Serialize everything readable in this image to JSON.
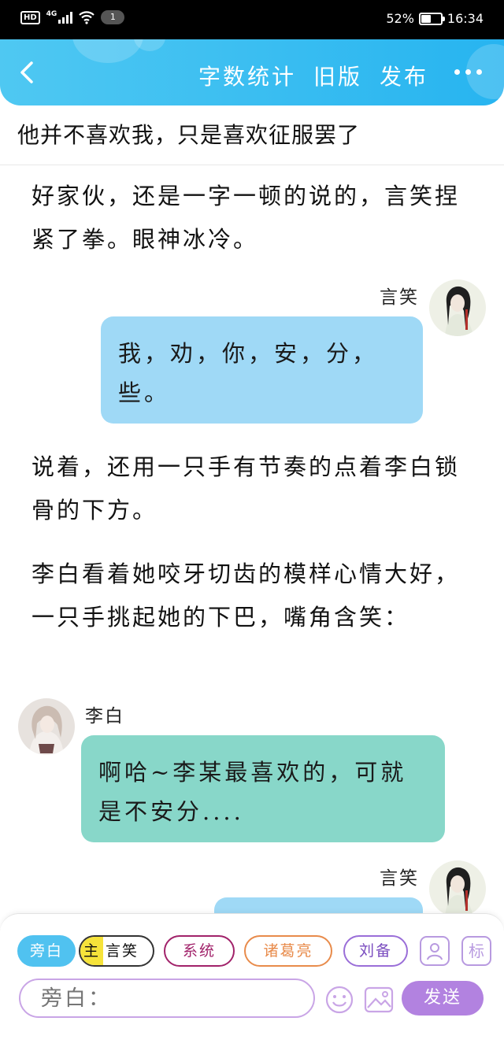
{
  "status_bar": {
    "hd": "HD",
    "network": "4G",
    "notification_count": "1",
    "battery_percent": "52%",
    "battery_level": 0.52,
    "time": "16:34"
  },
  "header": {
    "actions": [
      "字数统计",
      "旧版",
      "发布"
    ],
    "accent_color": "#27b4f0"
  },
  "chapter_title": "他并不喜欢我，只是喜欢征服罢了",
  "content": {
    "p1": "好家伙，还是一字一顿的说的，言笑捏紧了拳。眼神冰冷。",
    "msg1": {
      "speaker": "言笑",
      "text": "我，劝，你，安，分，些。",
      "avatar_icon": "character-avatar-yanxiao"
    },
    "p2": "说着，还用一只手有节奏的点着李白锁骨的下方。",
    "p3": "李白看着她咬牙切齿的模样心情大好，一只手挑起她的下巴，嘴角含笑：",
    "msg2": {
      "speaker": "李白",
      "text": "啊哈~李某最喜欢的，可就是不安分....",
      "avatar_icon": "character-avatar-libai"
    },
    "msg3": {
      "speaker": "言笑",
      "text": ""
    }
  },
  "roles": {
    "narrator": "旁白",
    "main_badge": "主",
    "main_role": "言笑",
    "system": "系统",
    "zhuge": "诸葛亮",
    "liubei": "刘备",
    "role_icon": "person-card-icon",
    "mark_label": "标"
  },
  "composer": {
    "placeholder": "旁白：",
    "send_label": "发送",
    "emoji_icon": "smiley-icon",
    "image_icon": "image-icon"
  }
}
